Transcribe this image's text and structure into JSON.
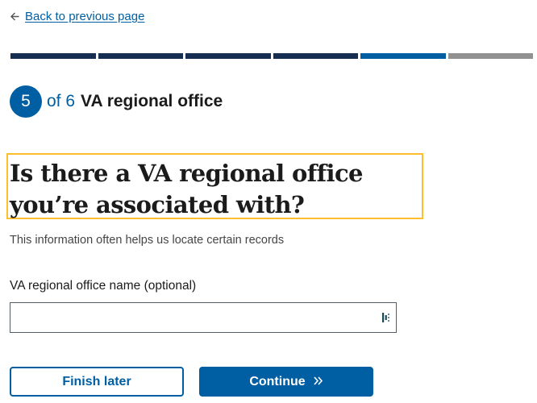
{
  "nav": {
    "back_label": "Back to previous page",
    "back_icon": "arrow-left-icon"
  },
  "progress": {
    "total_segments": 6,
    "current": 5
  },
  "step": {
    "number": "5",
    "of_text": "of 6",
    "title": "VA regional office"
  },
  "question": {
    "heading": "Is there a VA regional office you’re associated with?",
    "hint": "This information often helps us locate certain records"
  },
  "field": {
    "label": "VA regional office name (optional)",
    "value": "",
    "placeholder": ""
  },
  "actions": {
    "finish_later": "Finish later",
    "continue": "Continue",
    "continue_icon": "chevron-double-right-icon"
  },
  "colors": {
    "primary": "#005ea2",
    "primary_dark": "#162e51",
    "focus": "#ffbe2e",
    "inactive": "#919191"
  }
}
